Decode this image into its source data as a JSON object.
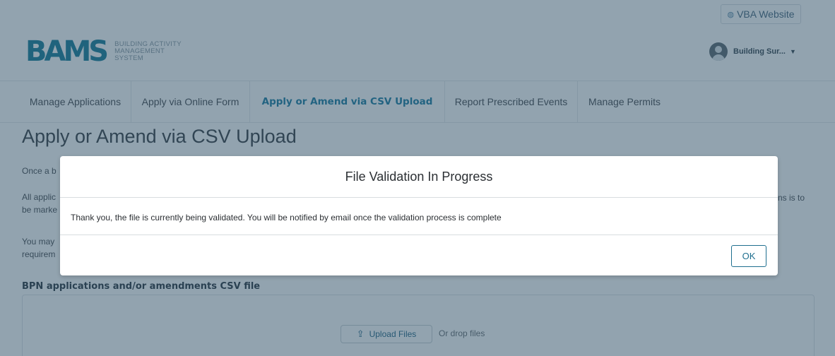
{
  "header": {
    "external_link_label": "VBA Website",
    "logo_mark": "BAMS",
    "logo_lines": [
      "BUILDING ACTIVITY",
      "MANAGEMENT",
      "SYSTEM"
    ],
    "user_name": "Building Sur..."
  },
  "nav": {
    "tabs": [
      {
        "label": "Manage Applications",
        "active": false
      },
      {
        "label": "Apply via Online Form",
        "active": false
      },
      {
        "label": "Apply or Amend via CSV Upload",
        "active": true
      },
      {
        "label": "Report Prescribed Events",
        "active": false
      },
      {
        "label": "Manage Permits",
        "active": false
      }
    ]
  },
  "main": {
    "title": "Apply or Amend via CSV Upload",
    "paragraphs": [
      "Once a b",
      "All applic",
      "be marke",
      "You may",
      "requirem"
    ],
    "right_fragment": "ns is to",
    "section_label": "BPN applications and/or amendments CSV file",
    "upload_button_label": "Upload Files",
    "drop_text": "Or drop files"
  },
  "modal": {
    "title": "File Validation In Progress",
    "message": "Thank you, the file is currently being validated. You will be notified by email once the validation process is complete",
    "ok_label": "OK"
  },
  "colors": {
    "accent": "#1f7ea3",
    "overlay": "#264860",
    "logo": "#1a7f9a"
  },
  "icons": {
    "external_link": "globe-icon",
    "avatar": "user-avatar-icon",
    "dropdown": "caret-down-icon",
    "upload": "upload-icon"
  }
}
